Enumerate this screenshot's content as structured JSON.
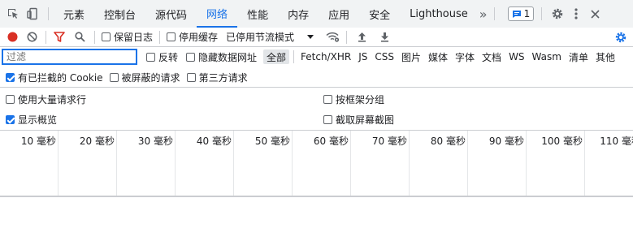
{
  "tabs": {
    "items": [
      "元素",
      "控制台",
      "源代码",
      "网络",
      "性能",
      "内存",
      "应用",
      "安全",
      "Lighthouse"
    ],
    "active_index": 3,
    "more": "»",
    "issues_count": "1"
  },
  "toolbar": {
    "preserve_log": "保留日志",
    "disable_cache": "停用缓存",
    "throttle": "已停用节流模式"
  },
  "filter": {
    "placeholder": "过滤",
    "invert": "反转",
    "hide_data_urls": "隐藏数据网址",
    "types": [
      "全部",
      "Fetch/XHR",
      "JS",
      "CSS",
      "图片",
      "媒体",
      "字体",
      "文档",
      "WS",
      "Wasm",
      "清单",
      "其他"
    ]
  },
  "flags": {
    "blocked_cookies": "有已拦截的 Cookie",
    "blocked_requests": "被屏蔽的请求",
    "third_party": "第三方请求"
  },
  "settings": {
    "large_rows": "使用大量请求行",
    "group_by_frame": "按框架分组",
    "show_overview": "显示概览",
    "capture_screenshots": "截取屏幕截图"
  },
  "timeline": {
    "ticks": [
      "10 毫秒",
      "20 毫秒",
      "30 毫秒",
      "40 毫秒",
      "50 毫秒",
      "60 毫秒",
      "70 毫秒",
      "80 毫秒",
      "90 毫秒",
      "100 毫秒",
      "110 毫秒"
    ]
  },
  "colors": {
    "accent": "#1a73e8",
    "record": "#d93025",
    "filter_active": "#d93025"
  }
}
